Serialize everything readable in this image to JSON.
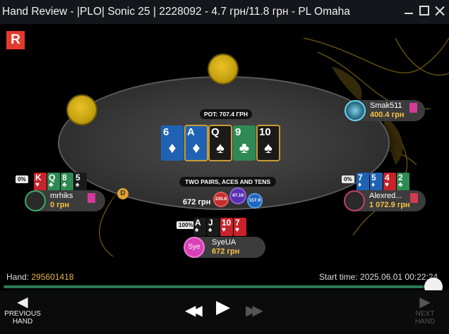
{
  "window": {
    "title": "Hand Review - |PLO| Sonic 25 | 2228092 - 4.7 грн/11.8 грн - PL Omaha"
  },
  "logo": "R",
  "table": {
    "pot_label": "POT: 707.4 ГРН",
    "hand_description": "TWO PAIRS, ACES AND TENS",
    "pot_amount": "672 грн",
    "chips": [
      "235.8",
      "47.16",
      "117.9"
    ],
    "dealer_label": "D",
    "board": [
      {
        "rank": "6",
        "suit": "♦",
        "color": "diamond",
        "highlight": false
      },
      {
        "rank": "A",
        "suit": "♦",
        "color": "diamond",
        "highlight": true
      },
      {
        "rank": "Q",
        "suit": "♠",
        "color": "spade",
        "highlight": true
      },
      {
        "rank": "9",
        "suit": "♣",
        "color": "club",
        "highlight": false
      },
      {
        "rank": "10",
        "suit": "♠",
        "color": "spade",
        "highlight": true
      }
    ]
  },
  "players": {
    "top_right": {
      "name": "Smak511",
      "stack": "400.4 грн"
    },
    "left": {
      "name": "mrhiks",
      "stack": "0 грн",
      "equity": "0%",
      "cards": [
        {
          "rank": "K",
          "suit": "♥",
          "color": "heart"
        },
        {
          "rank": "Q",
          "suit": "♣",
          "color": "club"
        },
        {
          "rank": "8",
          "suit": "♣",
          "color": "club"
        },
        {
          "rank": "5",
          "suit": "♠",
          "color": "spade"
        }
      ]
    },
    "right": {
      "name": "Alexred...",
      "stack": "1 072.9 грн",
      "equity": "0%",
      "cards": [
        {
          "rank": "7",
          "suit": "♦",
          "color": "diamond"
        },
        {
          "rank": "5",
          "suit": "♦",
          "color": "diamond"
        },
        {
          "rank": "4",
          "suit": "♥",
          "color": "heart"
        },
        {
          "rank": "2",
          "suit": "♣",
          "color": "club"
        }
      ]
    },
    "bottom": {
      "name": "SyeUA",
      "stack": "672 грн",
      "equity": "100%",
      "avatar": "Sye",
      "cards": [
        {
          "rank": "A",
          "suit": "♠",
          "color": "spade"
        },
        {
          "rank": "J",
          "suit": "♠",
          "color": "spade"
        },
        {
          "rank": "10",
          "suit": "♥",
          "color": "heart"
        },
        {
          "rank": "7",
          "suit": "♥",
          "color": "heart"
        }
      ]
    }
  },
  "footer": {
    "hand_label": "Hand:",
    "hand_number": "295601418",
    "start_time_label": "Start time:",
    "start_time": "2025.06.01 00:22:24",
    "progress": 0.98
  },
  "controls": {
    "previous_label": "PREVIOUS HAND",
    "next_label": "NEXT HAND"
  },
  "colors": {
    "accent": "#f6c343",
    "progress": "#2c7a55",
    "logo": "#e43a2c"
  }
}
